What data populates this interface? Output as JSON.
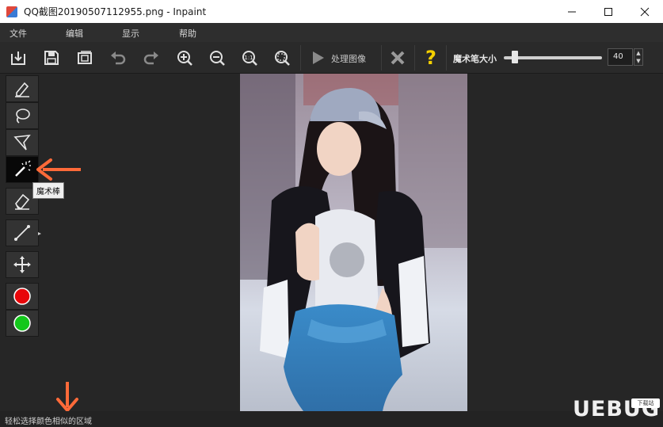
{
  "window": {
    "title": "QQ截图20190507112955.png - Inpaint"
  },
  "menu": {
    "file": "文件",
    "edit": "编辑",
    "view": "显示",
    "help": "帮助"
  },
  "toolbar": {
    "process_label": "处理图像",
    "help_glyph": "?",
    "brush_size_label": "魔术笔大小",
    "brush_size_value": "40",
    "brush_size_range": [
      1,
      100
    ]
  },
  "tooltip": {
    "text": "魔术棒"
  },
  "status": {
    "text": "轻松选择颜色相似的区域"
  },
  "colors": {
    "accent_arrow": "#ff6a39",
    "red_marker": "#e8060a",
    "green_marker": "#13c71b",
    "help_yellow": "#f4d000"
  },
  "watermark": {
    "text": "UEBUG",
    "badge": "下载站"
  }
}
